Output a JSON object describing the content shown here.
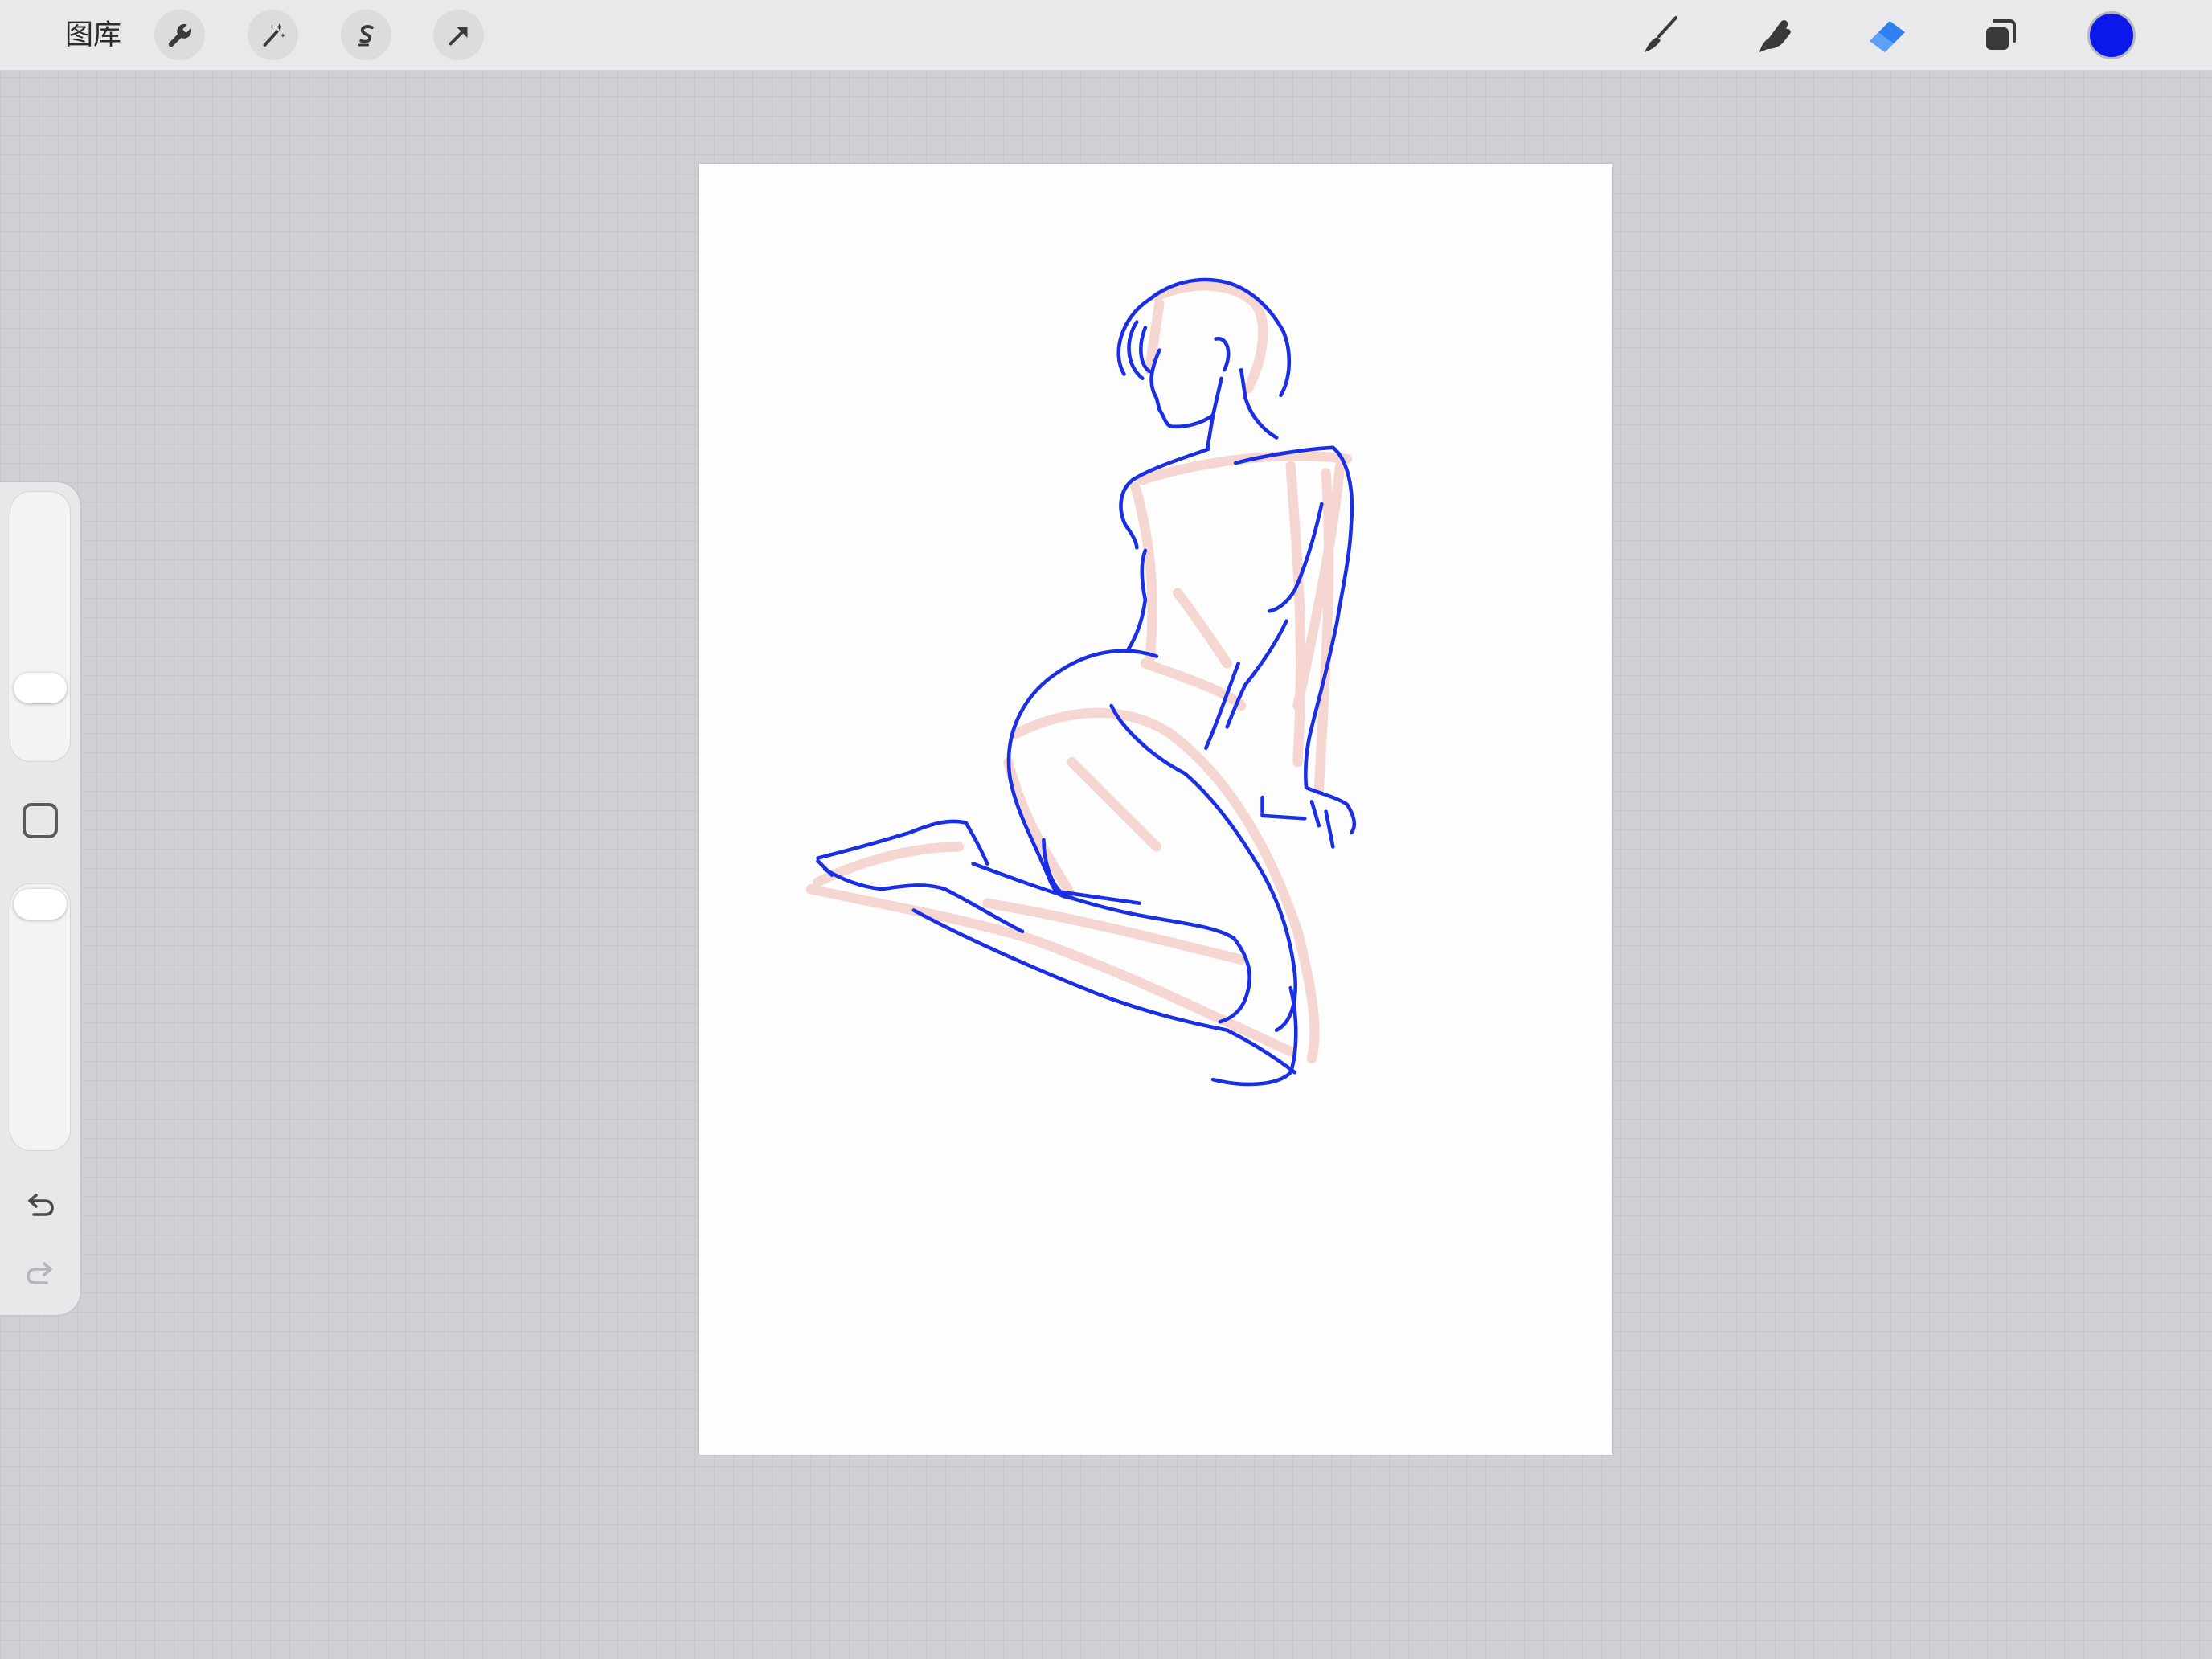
{
  "app": {
    "gallery_label": "图库"
  },
  "toolbar_left": [
    {
      "icon": "wrench-icon",
      "tool": "actions"
    },
    {
      "icon": "magic-wand-icon",
      "tool": "adjustments"
    },
    {
      "icon": "selection-icon",
      "tool": "selection"
    },
    {
      "icon": "transform-arrow-icon",
      "tool": "transform"
    }
  ],
  "toolbar_right": {
    "tools": [
      "brush-icon",
      "smudge-icon",
      "eraser-icon",
      "layers-icon"
    ],
    "active_tool": "eraser",
    "current_color": "#0a19ea"
  },
  "sidebar": {
    "brush_size": 0.23,
    "opacity": 1.0,
    "undo_icon": "undo-icon",
    "redo_icon": "redo-icon",
    "redo_enabled": false
  },
  "colors": {
    "accent": "#2d7ff2",
    "icon": "#3a3a3c",
    "lineart": "#1a2fe3",
    "underlay": "#f2c6bd"
  }
}
